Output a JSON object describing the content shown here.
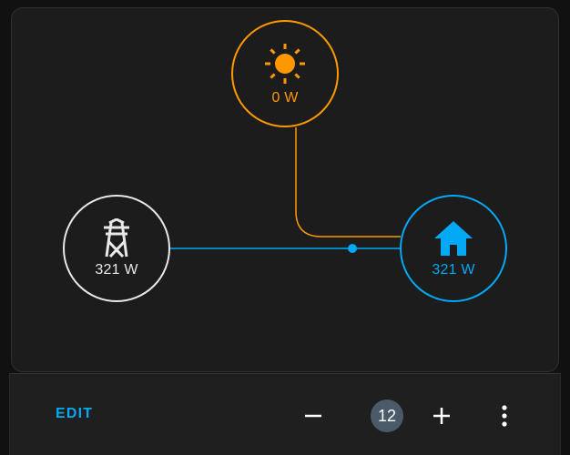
{
  "energy_card": {
    "solar": {
      "value": "0 W",
      "icon": "sun-icon",
      "color": "#ff9800"
    },
    "grid": {
      "value": "321 W",
      "icon": "transmission-tower-icon",
      "color": "#e8e8e8"
    },
    "home": {
      "value": "321 W",
      "icon": "home-icon",
      "color": "#03a9f4"
    }
  },
  "toolbar": {
    "edit_label": "EDIT",
    "count": "12",
    "minus_icon": "minus-icon",
    "plus_icon": "plus-icon",
    "more_icon": "more-vertical-icon"
  }
}
